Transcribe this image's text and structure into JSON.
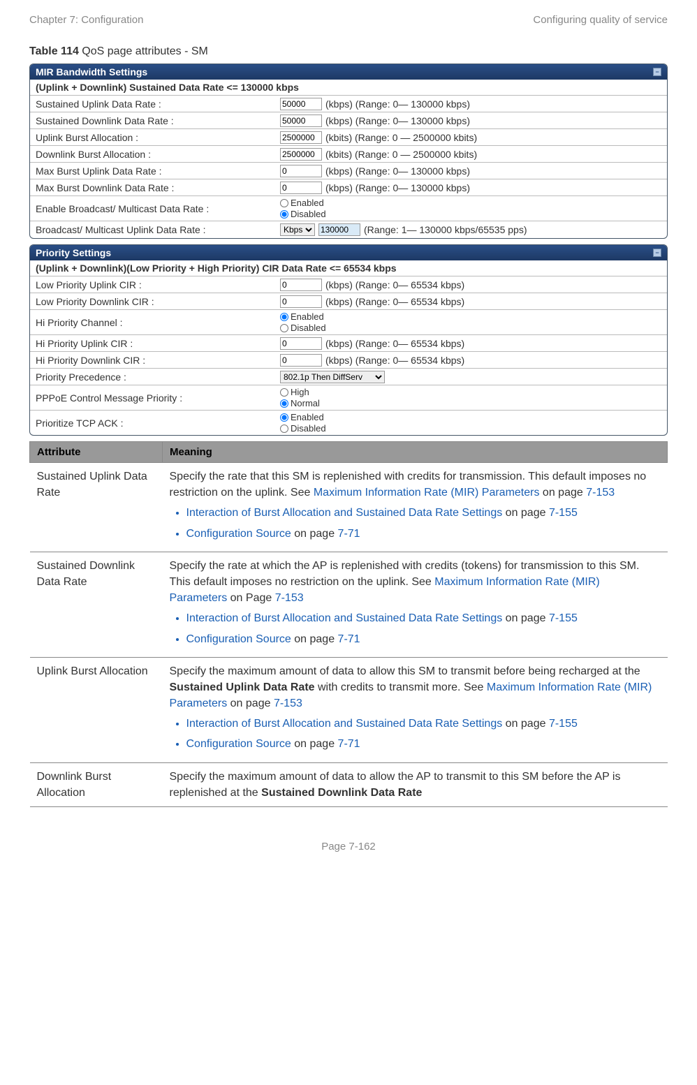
{
  "header": {
    "left": "Chapter 7:  Configuration",
    "right": "Configuring quality of service"
  },
  "caption": {
    "bold": "Table 114",
    "rest": " QoS page attributes - SM"
  },
  "panel1": {
    "title": "MIR Bandwidth Settings",
    "sub_prefix": "(Uplink + Downlink) Sustained Data Rate <= 130000 ",
    "sub_unit": "kbps",
    "rows": {
      "r0": {
        "label": "Sustained Uplink Data Rate :",
        "value": "50000",
        "hint": "(kbps) (Range: 0— 130000 kbps)"
      },
      "r1": {
        "label": "Sustained Downlink Data Rate :",
        "value": "50000",
        "hint": "(kbps) (Range: 0— 130000 kbps)"
      },
      "r2": {
        "label": "Uplink Burst Allocation :",
        "value": "2500000",
        "hint": "(kbits) (Range: 0 — 2500000 kbits)"
      },
      "r3": {
        "label": "Downlink Burst Allocation :",
        "value": "2500000",
        "hint": "(kbits) (Range: 0 — 2500000 kbits)"
      },
      "r4": {
        "label": "Max Burst Uplink Data Rate :",
        "value": "0",
        "hint": "(kbps) (Range: 0— 130000 kbps)"
      },
      "r5": {
        "label": "Max Burst Downlink Data Rate :",
        "value": "0",
        "hint": "(kbps) (Range: 0— 130000 kbps)"
      },
      "r6": {
        "label": "Enable Broadcast/ Multicast Data Rate :",
        "opt1": "Enabled",
        "opt2": "Disabled"
      },
      "r7": {
        "label": "Broadcast/ Multicast Uplink Data Rate :",
        "sel": "Kbps",
        "value": "130000",
        "hint": "(Range: 1— 130000 kbps/65535 pps)"
      }
    }
  },
  "panel2": {
    "title": "Priority Settings",
    "sub_prefix": "(Uplink + Downlink)(Low Priority + High Priority) CIR Data Rate <= 65534 ",
    "sub_unit": "kbps",
    "rows": {
      "r0": {
        "label": "Low Priority Uplink CIR :",
        "value": "0",
        "hint": "(kbps) (Range: 0— 65534 kbps)"
      },
      "r1": {
        "label": "Low Priority Downlink CIR :",
        "value": "0",
        "hint": "(kbps) (Range: 0— 65534 kbps)"
      },
      "r2": {
        "label": "Hi Priority Channel :",
        "opt1": "Enabled",
        "opt2": "Disabled"
      },
      "r3": {
        "label": "Hi Priority Uplink CIR :",
        "value": "0",
        "hint": "(kbps) (Range: 0— 65534 kbps)"
      },
      "r4": {
        "label": "Hi Priority Downlink CIR :",
        "value": "0",
        "hint": "(kbps) (Range: 0— 65534 kbps)"
      },
      "r5": {
        "label": "Priority Precedence :",
        "sel": "802.1p Then DiffServ"
      },
      "r6": {
        "label": "PPPoE Control Message Priority :",
        "opt1": "High",
        "opt2": "Normal"
      },
      "r7": {
        "label": "Prioritize TCP ACK :",
        "opt1": "Enabled",
        "opt2": "Disabled"
      }
    }
  },
  "attrTable": {
    "h1": "Attribute",
    "h2": "Meaning",
    "rows": {
      "r0": {
        "attr": "Sustained Uplink Data Rate",
        "p_pre": "Specify the rate that this SM is replenished with credits for transmission. This default imposes no restriction on the uplink. See ",
        "link1": "Maximum Information Rate (MIR) Parameters",
        "p_mid": " on page ",
        "pg1": "7-153",
        "b1_link": "Interaction of Burst Allocation and Sustained Data Rate Settings",
        "b1_mid": " on page ",
        "b1_pg": "7-155",
        "b2_link": "Configuration Source",
        "b2_mid": " on page ",
        "b2_pg": "7-71"
      },
      "r1": {
        "attr": "Sustained Downlink Data Rate",
        "p_pre": "Specify the rate at which the AP is replenished with credits (tokens) for transmission to this SM. This default imposes no restriction on the uplink. See ",
        "link1": "Maximum Information Rate (MIR) Parameters",
        "p_mid": " on Page ",
        "pg1": "7-153",
        "b1_link": "Interaction of Burst Allocation and Sustained Data Rate Settings",
        "b1_mid": " on page ",
        "b1_pg": "7-155",
        "b2_link": "Configuration Source",
        "b2_mid": " on page ",
        "b2_pg": "7-71"
      },
      "r2": {
        "attr": "Uplink Burst Allocation",
        "p_pre": "Specify the maximum amount of data to allow this SM to transmit before being recharged at the ",
        "bold1": "Sustained Uplink Data Rate",
        "p_mid1": " with credits to transmit more. See ",
        "link1": "Maximum Information Rate (MIR) Parameters",
        "p_mid": " on page ",
        "pg1": "7-153",
        "b1_link": "Interaction of Burst Allocation and Sustained Data Rate Settings",
        "b1_mid": " on page ",
        "b1_pg": "7-155",
        "b2_link": "Configuration Source",
        "b2_mid": " on page ",
        "b2_pg": "7-71"
      },
      "r3": {
        "attr": "Downlink Burst Allocation",
        "p_pre": "Specify the maximum amount of data to allow the AP to transmit to this SM before the AP is replenished at the ",
        "bold1": "Sustained Downlink Data Rate"
      }
    }
  },
  "footer": "Page 7-162"
}
